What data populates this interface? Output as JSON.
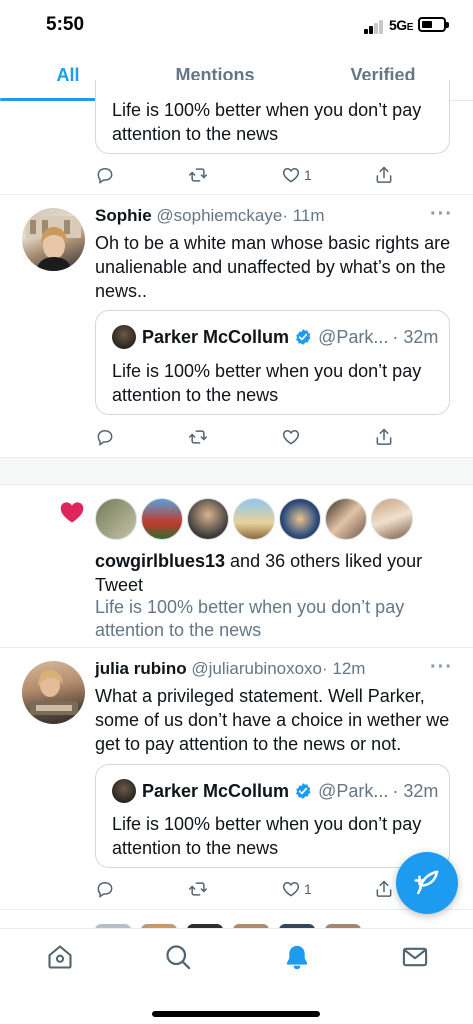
{
  "status_bar": {
    "time": "5:50",
    "network": "5G",
    "network_suffix": "E"
  },
  "tabs": [
    {
      "label": "All",
      "active": true
    },
    {
      "label": "Mentions",
      "active": false
    },
    {
      "label": "Verified",
      "active": false
    }
  ],
  "top_quote": {
    "text": "Life is 100% better when you don’t pay attention to the news",
    "like_count": "1"
  },
  "tweet1": {
    "name": "Sophie",
    "handle": "@sophiemckaye",
    "time": "· 11m",
    "text": "Oh to be a white man whose basic rights are unalienable and unaffected by what’s on the news..",
    "quote": {
      "name": "Parker McCollum",
      "handle": "@Park...",
      "time": "· 32m",
      "text": "Life is 100% better when you don’t pay attention to the news"
    }
  },
  "like_notification": {
    "user": "cowgirlblues13",
    "rest": " and 36 others liked your Tweet",
    "quote": "Life is 100% better when you don’t pay attention to the news"
  },
  "tweet2": {
    "name": "julia rubino",
    "handle": "@juliarubinoxoxo",
    "time": "· 12m",
    "text": "What a privileged statement. Well Parker, some of us don’t have a choice in wether we get to pay attention to the news or not.",
    "like_count": "1",
    "quote": {
      "name": "Parker McCollum",
      "handle": "@Park...",
      "time": "· 32m",
      "text": "Life is 100% better when you don’t pay attention to the news"
    }
  },
  "more_glyph": "···",
  "colors": {
    "accent": "#1d9bf0",
    "like_red": "#e0245e",
    "muted": "#657786"
  },
  "icons": [
    "reply-icon",
    "retweet-icon",
    "like-icon",
    "share-icon",
    "compose-tweet-icon",
    "home-icon",
    "search-icon",
    "notifications-icon",
    "messages-icon"
  ]
}
